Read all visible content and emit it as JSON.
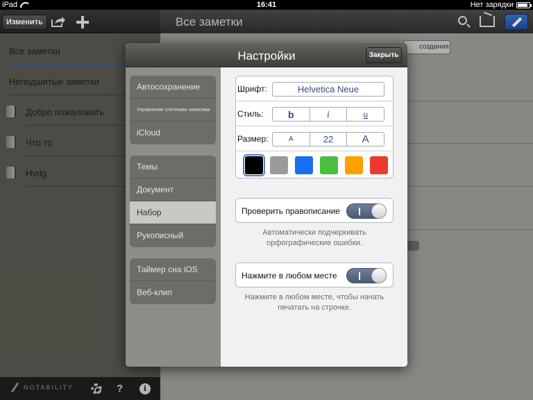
{
  "status_bar": {
    "device": "iPad",
    "time": "16:41",
    "charging": "Нет зарядки"
  },
  "left_toolbar": {
    "edit_label": "Изменить"
  },
  "left_list": {
    "items": [
      {
        "label": "Все заметки",
        "type": "category",
        "active": true
      },
      {
        "label": "Неподшитые заметки",
        "type": "category",
        "active": false
      },
      {
        "label": "Добро пожаловать",
        "type": "note"
      },
      {
        "label": "Что то",
        "type": "note"
      },
      {
        "label": "Hvdg",
        "type": "note"
      }
    ]
  },
  "left_footer": {
    "brand": "NOTABILITY",
    "help": "?",
    "info": "i"
  },
  "right_toolbar": {
    "title": "Все заметки"
  },
  "right_content": {
    "sort_label": "создания"
  },
  "settings": {
    "title": "Настройки",
    "close_label": "Закрыть",
    "menu_groups": [
      [
        "Автосохранение",
        "Управление учетными записями",
        "iCloud"
      ],
      [
        "Темы",
        "Документ",
        "Набор",
        "Рукописный"
      ],
      [
        "Таймер сна iOS",
        "Веб-клип"
      ]
    ],
    "selected_item": "Набор",
    "font": {
      "font_label": "Шрифт:",
      "font_value": "Helvetica Neue",
      "style_label": "Стиль:",
      "style_bold": "b",
      "style_italic": "i",
      "style_underline": "u",
      "size_label": "Размер:",
      "size_decrease": "A",
      "size_value": "22",
      "size_increase": "A",
      "colors": [
        "#000000",
        "#9a9a9a",
        "#1a6ef0",
        "#4cbf3c",
        "#ff9f00",
        "#ee3a2b"
      ],
      "selected_color": "#000000"
    },
    "spellcheck": {
      "label": "Проверить правописание",
      "on": true,
      "hint_line1": "Автоматически подчеркивать",
      "hint_line2": "орфографические ошибки."
    },
    "tap_anywhere": {
      "label": "Нажмите в любом месте",
      "on": true,
      "hint_line1": "Нажмите в любом месте, чтобы начать",
      "hint_line2": "печатать на строчке."
    }
  }
}
